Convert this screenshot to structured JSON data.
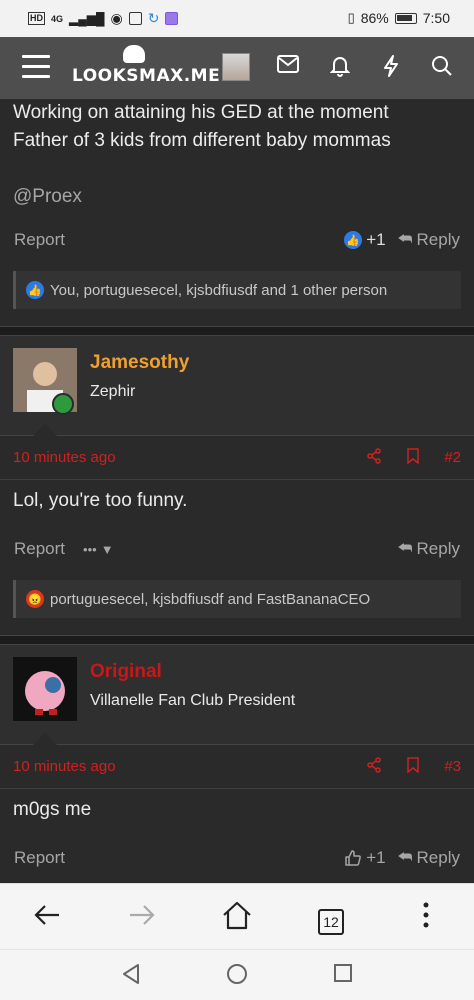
{
  "status_bar": {
    "left_icons": [
      "hd-icon",
      "signal-icon",
      "eye-icon",
      "photo-icon",
      "loop-icon",
      "app-icon"
    ],
    "hd": "HD",
    "net": "4G",
    "battery": "86%",
    "time": "7:50"
  },
  "header": {
    "site_name": "LOOKSMAX.ME",
    "icons": [
      "menu-icon",
      "mail-icon",
      "bell-icon",
      "bolt-icon",
      "search-icon"
    ]
  },
  "posts": [
    {
      "lines": [
        "Working on attaining his GED at the moment",
        "Father of 3 kids from different baby mommas"
      ],
      "mention": "@Proex",
      "report": "Report",
      "like_count": "+1",
      "reply": "Reply",
      "reactions": "You, portuguesecel, kjsbdfiusdf and 1 other person"
    },
    {
      "username": "Jamesothy",
      "user_title": "Zephir",
      "time": "10 minutes ago",
      "post_number": "#2",
      "text": "Lol, you're too funny.",
      "report": "Report",
      "more": "•••",
      "reply": "Reply",
      "reactions": "portuguesecel, kjsbdfiusdf and FastBananaCEO"
    },
    {
      "username": "Original",
      "user_title": "Villanelle Fan Club President",
      "time": "10 minutes ago",
      "post_number": "#3",
      "text": "m0gs me",
      "report": "Report",
      "like_count": "+1",
      "reply": "Reply"
    }
  ],
  "colors": {
    "accent_orange": "#f0a030",
    "accent_red": "#d02020",
    "header_bg": "#4e4e4e",
    "page_bg": "#2a2a2a"
  },
  "browser_nav": {
    "tab_count": "12"
  }
}
